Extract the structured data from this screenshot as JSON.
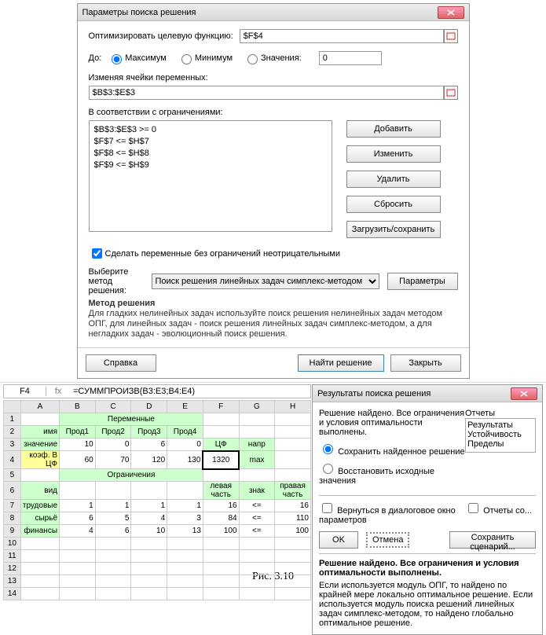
{
  "solver": {
    "title": "Параметры поиска решения",
    "objective_label": "Оптимизировать целевую функцию:",
    "objective_value": "$F$4",
    "to_label": "До:",
    "radios": {
      "max": "Максимум",
      "min": "Минимум",
      "val": "Значения:"
    },
    "value_field": "0",
    "changing_label": "Изменяя ячейки переменных:",
    "changing_value": "$B$3:$E$3",
    "constraints_label": "В соответствии с ограничениями:",
    "constraints": [
      "$B$3:$E$3 >= 0",
      "$F$7 <= $H$7",
      "$F$8 <= $H$8",
      "$F$9 <= $H$9"
    ],
    "buttons": {
      "add": "Добавить",
      "change": "Изменить",
      "delete": "Удалить",
      "reset": "Сбросить",
      "loadsave": "Загрузить/сохранить"
    },
    "nonneg_label": "Сделать переменные без ограничений неотрицательными",
    "method_label": "Выберите метод решения:",
    "method_value": "Поиск решения линейных задач симплекс-методом",
    "params_btn": "Параметры",
    "method_hdr": "Метод решения",
    "method_desc": "Для гладких нелинейных задач используйте поиск решения нелинейных задач методом ОПГ, для линейных задач - поиск решения линейных задач симплекс-методом, а для негладких задач - эволюционный поиск решения.",
    "help": "Справка",
    "solve": "Найти решение",
    "close": "Закрыть"
  },
  "sheet": {
    "namebox": "F4",
    "fx": "fx",
    "formula": "=СУММПРОИЗВ(B3:E3;B4:E4)",
    "cols": [
      "",
      "A",
      "B",
      "C",
      "D",
      "E",
      "F",
      "G",
      "H"
    ],
    "vars_hdr": "Переменные",
    "rows": [
      [
        "1",
        "имя",
        "Прод1",
        "Прод2",
        "Прод3",
        "Прод4",
        "",
        "",
        ""
      ],
      [
        "2",
        "значение",
        "10",
        "0",
        "6",
        "0",
        "ЦФ",
        "напр",
        ""
      ],
      [
        "3",
        "коэф. В ЦФ",
        "60",
        "70",
        "120",
        "130",
        "1320",
        "max",
        ""
      ]
    ],
    "constr_hdr": "Ограничения",
    "constr_cols": [
      "левая часть",
      "знак",
      "правая часть"
    ],
    "crows": [
      [
        "7",
        "вид",
        "",
        "",
        "",
        "",
        "",
        "",
        ""
      ],
      [
        "8",
        "трудовые",
        "1",
        "1",
        "1",
        "1",
        "16",
        "<=",
        "16"
      ],
      [
        "9",
        "сырьё",
        "6",
        "5",
        "4",
        "3",
        "84",
        "<=",
        "110"
      ],
      [
        "10",
        "финансы",
        "4",
        "6",
        "10",
        "13",
        "100",
        "<=",
        "100"
      ]
    ]
  },
  "results": {
    "title": "Результаты поиска решения",
    "found": "Решение найдено. Все ограничения и условия оптимальности выполнены.",
    "keep": "Сохранить найденное решение",
    "restore": "Восстановить исходные значения",
    "reports_lbl": "Отчеты",
    "reports": [
      "Результаты",
      "Устойчивость",
      "Пределы"
    ],
    "return_dlg": "Вернуться в диалоговое окно параметров",
    "out_reports": "Отчеты со...",
    "ok": "OK",
    "cancel": "Отмена",
    "save_scen": "Сохранить сценарий...",
    "bold_line": "Решение найдено. Все ограничения и условия оптимальности выполнены.",
    "note": "Если используется модуль ОПГ, то найдено по крайней мере локально оптимальное решение. Если используется модуль поиска решений линейных задач симплекс-методом, то найдено глобально оптимальное решение."
  },
  "caption": "Рис. 3.10"
}
